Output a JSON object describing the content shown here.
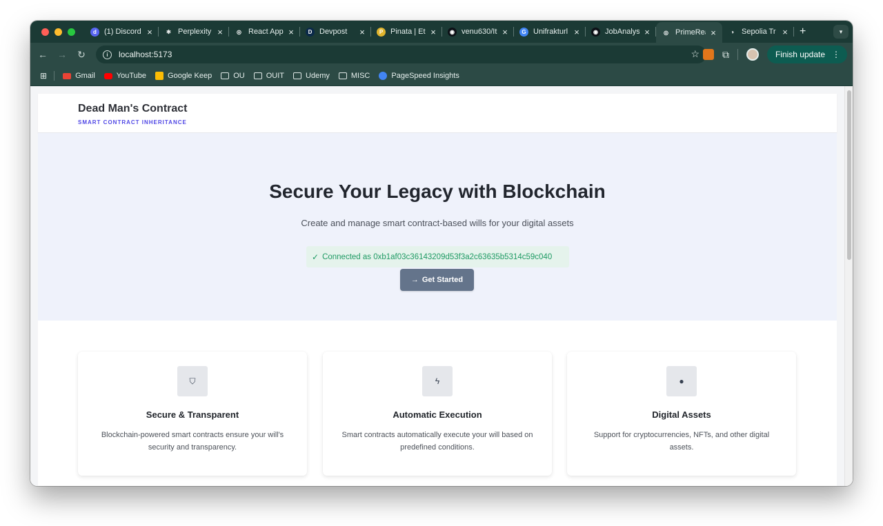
{
  "browser": {
    "tabs": [
      {
        "title": "(1) Discord",
        "favicon_color": "#5865f2",
        "glyph": "d"
      },
      {
        "title": "Perplexity",
        "favicon_color": "#1b3a35",
        "glyph": "✻"
      },
      {
        "title": "React App",
        "favicon_color": "#1b3a35",
        "glyph": "◎"
      },
      {
        "title": "Devpost",
        "favicon_color": "#0b2a4a",
        "glyph": "D"
      },
      {
        "title": "Pinata | Eth",
        "favicon_color": "#e0b52e",
        "glyph": "P"
      },
      {
        "title": "venu630/It",
        "favicon_color": "#0d1117",
        "glyph": "◉"
      },
      {
        "title": "Unifrakturl",
        "favicon_color": "#4285f4",
        "glyph": "G"
      },
      {
        "title": "JobAnalysis",
        "favicon_color": "#0d1117",
        "glyph": "◉"
      },
      {
        "title": "PrimeReact",
        "favicon_color": "#2c4a45",
        "glyph": "◎"
      },
      {
        "title": "Sepolia Tr",
        "favicon_color": "#1b3a35",
        "glyph": "◑"
      }
    ],
    "active_tab_index": 8,
    "url": "localhost:5173",
    "finish_update_label": "Finish update",
    "bookmarks": [
      {
        "label": "Gmail",
        "icon": "gmail-icon"
      },
      {
        "label": "YouTube",
        "icon": "youtube-icon"
      },
      {
        "label": "Google Keep",
        "icon": "keep-icon"
      },
      {
        "label": "OU",
        "icon": "folder-icon"
      },
      {
        "label": "OUIT",
        "icon": "folder-icon"
      },
      {
        "label": "Udemy",
        "icon": "folder-icon"
      },
      {
        "label": "MISC",
        "icon": "folder-icon"
      },
      {
        "label": "PageSpeed Insights",
        "icon": "pagespeed-icon"
      }
    ]
  },
  "site": {
    "brand": "Dead Man's Contract",
    "tagline": "SMART CONTRACT INHERITANCE",
    "hero": {
      "title": "Secure Your Legacy with Blockchain",
      "subtitle": "Create and manage smart contract-based wills for your digital assets",
      "connected_text": "Connected as 0xb1af03c36143209d53f3a2c63635b5314c59c040",
      "cta_label": "Get Started"
    },
    "features": [
      {
        "icon": "shield-icon",
        "glyph": "⛉",
        "title": "Secure & Transparent",
        "description": "Blockchain-powered smart contracts ensure your will's security and transparency."
      },
      {
        "icon": "bolt-icon",
        "glyph": "ϟ",
        "title": "Automatic Execution",
        "description": "Smart contracts automatically execute your will based on predefined conditions."
      },
      {
        "icon": "bitcoin-icon",
        "glyph": "●",
        "title": "Digital Assets",
        "description": "Support for cryptocurrencies, NFTs, and other digital assets."
      }
    ]
  },
  "colors": {
    "browser_frame": "#1b3a35",
    "toolbar": "#2c4a45",
    "accent": "#4f46e5",
    "success": "#1e9a63",
    "cta": "#64748b",
    "hero_bg": "#eff2fb"
  }
}
